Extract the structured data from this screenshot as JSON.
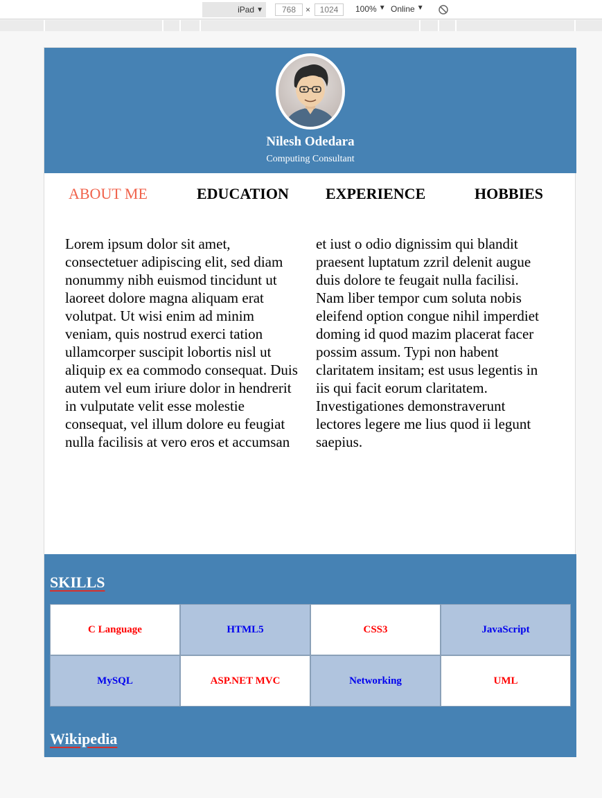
{
  "devtools": {
    "device": "iPad",
    "width": "768",
    "height": "1024",
    "times": "×",
    "zoom": "100%",
    "network": "Online"
  },
  "profile": {
    "name": "Nilesh Odedara",
    "role": "Computing Consultant"
  },
  "nav": {
    "items": [
      "ABOUT ME",
      "EDUCATION",
      "EXPERIENCE",
      "HOBBIES"
    ],
    "active": "ABOUT ME"
  },
  "about": {
    "text": "Lorem ipsum dolor sit amet, consectetuer adipiscing elit, sed diam nonummy nibh euismod tincidunt ut laoreet dolore magna aliquam erat volutpat. Ut wisi enim ad minim veniam, quis nostrud exerci tation ullamcorper suscipit lobortis nisl ut aliquip ex ea commodo consequat. Duis autem vel eum iriure dolor in hendrerit in vulputate velit esse molestie consequat, vel illum dolore eu feugiat nulla facilisis at vero eros et accumsan et iust o odio dignissim qui blandit praesent luptatum zzril delenit augue duis dolore te feugait nulla facilisi. Nam liber tempor cum soluta nobis eleifend option congue nihil imperdiet doming id quod mazim placerat facer possim assum. Typi non habent claritatem insitam; est usus legentis in iis qui facit eorum claritatem. Investigationes demonstraverunt lectores legere me lius quod ii legunt saepius."
  },
  "skills": {
    "title": "SKILLS",
    "items": [
      "C Language",
      "HTML5",
      "CSS3",
      "JavaScript",
      "MySQL",
      "ASP.NET MVC",
      "Networking",
      "UML"
    ]
  },
  "wikipedia": {
    "title": "Wikipedia"
  },
  "colors": {
    "header": "#4682b4",
    "active_nav": "#f0624b",
    "skill_blue": "#b0c4de"
  }
}
